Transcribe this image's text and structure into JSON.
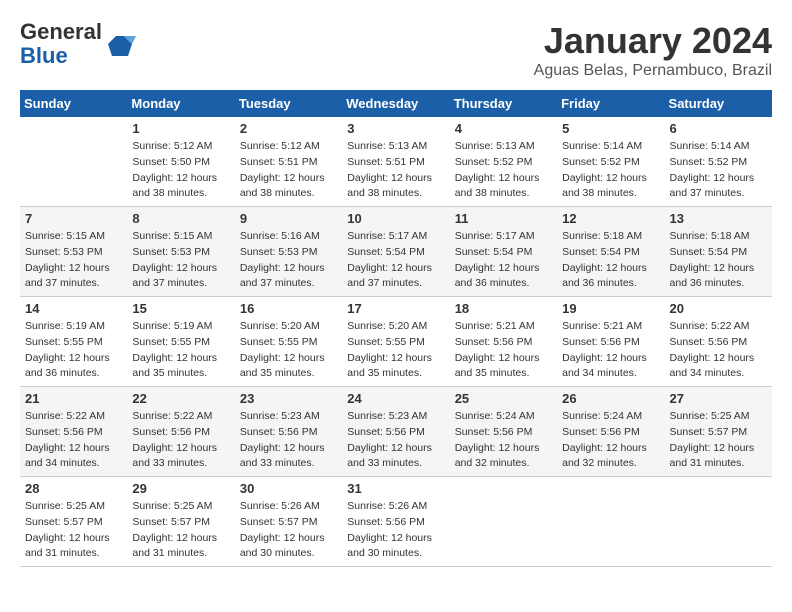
{
  "header": {
    "logo_general": "General",
    "logo_blue": "Blue",
    "title": "January 2024",
    "location": "Aguas Belas, Pernambuco, Brazil"
  },
  "days_of_week": [
    "Sunday",
    "Monday",
    "Tuesday",
    "Wednesday",
    "Thursday",
    "Friday",
    "Saturday"
  ],
  "weeks": [
    [
      {
        "num": "",
        "info": ""
      },
      {
        "num": "1",
        "info": "Sunrise: 5:12 AM\nSunset: 5:50 PM\nDaylight: 12 hours\nand 38 minutes."
      },
      {
        "num": "2",
        "info": "Sunrise: 5:12 AM\nSunset: 5:51 PM\nDaylight: 12 hours\nand 38 minutes."
      },
      {
        "num": "3",
        "info": "Sunrise: 5:13 AM\nSunset: 5:51 PM\nDaylight: 12 hours\nand 38 minutes."
      },
      {
        "num": "4",
        "info": "Sunrise: 5:13 AM\nSunset: 5:52 PM\nDaylight: 12 hours\nand 38 minutes."
      },
      {
        "num": "5",
        "info": "Sunrise: 5:14 AM\nSunset: 5:52 PM\nDaylight: 12 hours\nand 38 minutes."
      },
      {
        "num": "6",
        "info": "Sunrise: 5:14 AM\nSunset: 5:52 PM\nDaylight: 12 hours\nand 37 minutes."
      }
    ],
    [
      {
        "num": "7",
        "info": "Sunrise: 5:15 AM\nSunset: 5:53 PM\nDaylight: 12 hours\nand 37 minutes."
      },
      {
        "num": "8",
        "info": "Sunrise: 5:15 AM\nSunset: 5:53 PM\nDaylight: 12 hours\nand 37 minutes."
      },
      {
        "num": "9",
        "info": "Sunrise: 5:16 AM\nSunset: 5:53 PM\nDaylight: 12 hours\nand 37 minutes."
      },
      {
        "num": "10",
        "info": "Sunrise: 5:17 AM\nSunset: 5:54 PM\nDaylight: 12 hours\nand 37 minutes."
      },
      {
        "num": "11",
        "info": "Sunrise: 5:17 AM\nSunset: 5:54 PM\nDaylight: 12 hours\nand 36 minutes."
      },
      {
        "num": "12",
        "info": "Sunrise: 5:18 AM\nSunset: 5:54 PM\nDaylight: 12 hours\nand 36 minutes."
      },
      {
        "num": "13",
        "info": "Sunrise: 5:18 AM\nSunset: 5:54 PM\nDaylight: 12 hours\nand 36 minutes."
      }
    ],
    [
      {
        "num": "14",
        "info": "Sunrise: 5:19 AM\nSunset: 5:55 PM\nDaylight: 12 hours\nand 36 minutes."
      },
      {
        "num": "15",
        "info": "Sunrise: 5:19 AM\nSunset: 5:55 PM\nDaylight: 12 hours\nand 35 minutes."
      },
      {
        "num": "16",
        "info": "Sunrise: 5:20 AM\nSunset: 5:55 PM\nDaylight: 12 hours\nand 35 minutes."
      },
      {
        "num": "17",
        "info": "Sunrise: 5:20 AM\nSunset: 5:55 PM\nDaylight: 12 hours\nand 35 minutes."
      },
      {
        "num": "18",
        "info": "Sunrise: 5:21 AM\nSunset: 5:56 PM\nDaylight: 12 hours\nand 35 minutes."
      },
      {
        "num": "19",
        "info": "Sunrise: 5:21 AM\nSunset: 5:56 PM\nDaylight: 12 hours\nand 34 minutes."
      },
      {
        "num": "20",
        "info": "Sunrise: 5:22 AM\nSunset: 5:56 PM\nDaylight: 12 hours\nand 34 minutes."
      }
    ],
    [
      {
        "num": "21",
        "info": "Sunrise: 5:22 AM\nSunset: 5:56 PM\nDaylight: 12 hours\nand 34 minutes."
      },
      {
        "num": "22",
        "info": "Sunrise: 5:22 AM\nSunset: 5:56 PM\nDaylight: 12 hours\nand 33 minutes."
      },
      {
        "num": "23",
        "info": "Sunrise: 5:23 AM\nSunset: 5:56 PM\nDaylight: 12 hours\nand 33 minutes."
      },
      {
        "num": "24",
        "info": "Sunrise: 5:23 AM\nSunset: 5:56 PM\nDaylight: 12 hours\nand 33 minutes."
      },
      {
        "num": "25",
        "info": "Sunrise: 5:24 AM\nSunset: 5:56 PM\nDaylight: 12 hours\nand 32 minutes."
      },
      {
        "num": "26",
        "info": "Sunrise: 5:24 AM\nSunset: 5:56 PM\nDaylight: 12 hours\nand 32 minutes."
      },
      {
        "num": "27",
        "info": "Sunrise: 5:25 AM\nSunset: 5:57 PM\nDaylight: 12 hours\nand 31 minutes."
      }
    ],
    [
      {
        "num": "28",
        "info": "Sunrise: 5:25 AM\nSunset: 5:57 PM\nDaylight: 12 hours\nand 31 minutes."
      },
      {
        "num": "29",
        "info": "Sunrise: 5:25 AM\nSunset: 5:57 PM\nDaylight: 12 hours\nand 31 minutes."
      },
      {
        "num": "30",
        "info": "Sunrise: 5:26 AM\nSunset: 5:57 PM\nDaylight: 12 hours\nand 30 minutes."
      },
      {
        "num": "31",
        "info": "Sunrise: 5:26 AM\nSunset: 5:56 PM\nDaylight: 12 hours\nand 30 minutes."
      },
      {
        "num": "",
        "info": ""
      },
      {
        "num": "",
        "info": ""
      },
      {
        "num": "",
        "info": ""
      }
    ]
  ]
}
